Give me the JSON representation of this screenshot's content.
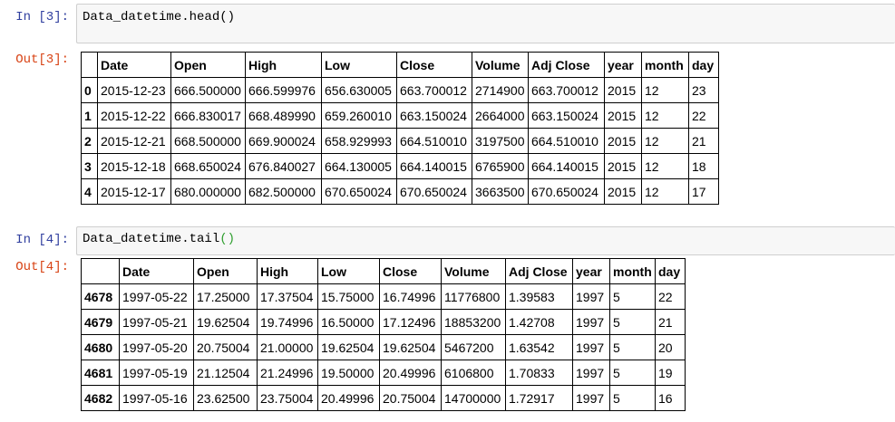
{
  "cells": [
    {
      "in_prompt": "In [3]:",
      "code": {
        "object": "Data_datetime",
        "method": ".head",
        "parens": "()"
      },
      "out_prompt": "Out[3]:",
      "columns": [
        "",
        "Date",
        "Open",
        "High",
        "Low",
        "Close",
        "Volume",
        "Adj Close",
        "year",
        "month",
        "day"
      ],
      "rows": [
        [
          "0",
          "2015-12-23",
          "666.500000",
          "666.599976",
          "656.630005",
          "663.700012",
          "2714900",
          "663.700012",
          "2015",
          "12",
          "23"
        ],
        [
          "1",
          "2015-12-22",
          "666.830017",
          "668.489990",
          "659.260010",
          "663.150024",
          "2664000",
          "663.150024",
          "2015",
          "12",
          "22"
        ],
        [
          "2",
          "2015-12-21",
          "668.500000",
          "669.900024",
          "658.929993",
          "664.510010",
          "3197500",
          "664.510010",
          "2015",
          "12",
          "21"
        ],
        [
          "3",
          "2015-12-18",
          "668.650024",
          "676.840027",
          "664.130005",
          "664.140015",
          "6765900",
          "664.140015",
          "2015",
          "12",
          "18"
        ],
        [
          "4",
          "2015-12-17",
          "680.000000",
          "682.500000",
          "670.650024",
          "670.650024",
          "3663500",
          "670.650024",
          "2015",
          "12",
          "17"
        ]
      ]
    },
    {
      "in_prompt": "In [4]:",
      "code": {
        "object": "Data_datetime",
        "method": ".tail",
        "parens": "()"
      },
      "out_prompt": "Out[4]:",
      "columns": [
        "",
        "Date",
        "Open",
        "High",
        "Low",
        "Close",
        "Volume",
        "Adj Close",
        "year",
        "month",
        "day"
      ],
      "rows": [
        [
          "4678",
          "1997-05-22",
          "17.25000",
          "17.37504",
          "15.75000",
          "16.74996",
          "11776800",
          "1.39583",
          "1997",
          "5",
          "22"
        ],
        [
          "4679",
          "1997-05-21",
          "19.62504",
          "19.74996",
          "16.50000",
          "17.12496",
          "18853200",
          "1.42708",
          "1997",
          "5",
          "21"
        ],
        [
          "4680",
          "1997-05-20",
          "20.75004",
          "21.00000",
          "19.62504",
          "19.62504",
          "5467200",
          "1.63542",
          "1997",
          "5",
          "20"
        ],
        [
          "4681",
          "1997-05-19",
          "21.12504",
          "21.24996",
          "19.50000",
          "20.49996",
          "6106800",
          "1.70833",
          "1997",
          "5",
          "19"
        ],
        [
          "4682",
          "1997-05-16",
          "23.62500",
          "23.75004",
          "20.49996",
          "20.75004",
          "14700000",
          "1.72917",
          "1997",
          "5",
          "16"
        ]
      ]
    }
  ]
}
